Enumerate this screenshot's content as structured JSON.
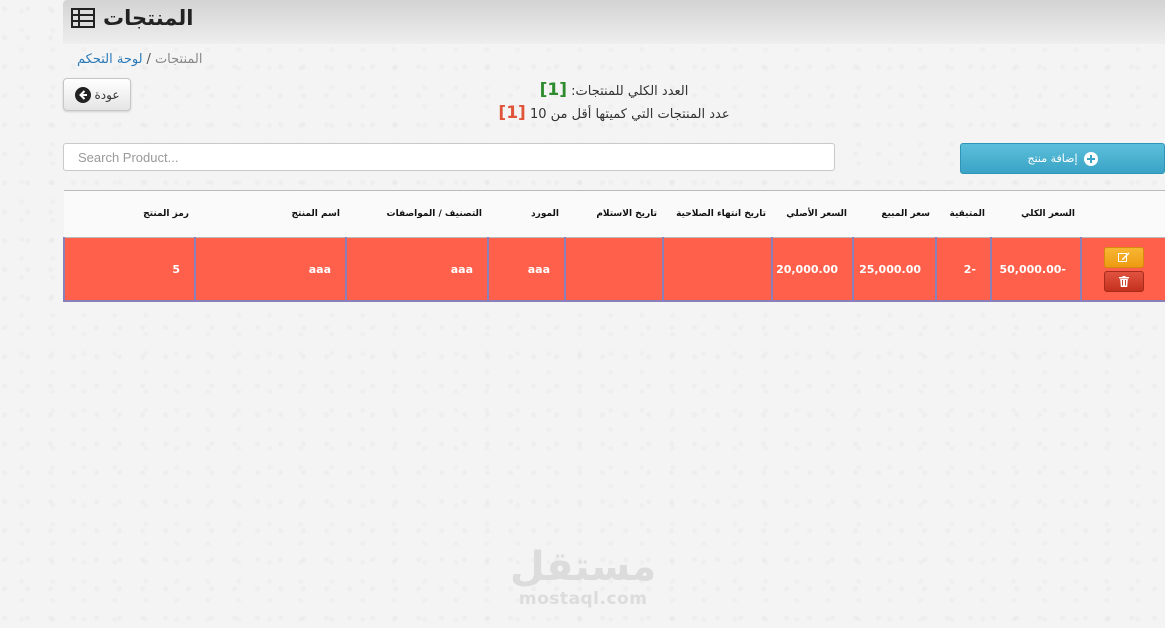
{
  "header": {
    "title": "المنتجات",
    "icon": "table-grid-icon"
  },
  "breadcrumb": {
    "current": "المنتجات",
    "separator": "/",
    "link": "لوحة التحكم"
  },
  "back_button": {
    "label": "عودة",
    "icon": "arrow-left-circle-icon"
  },
  "stats": {
    "total_label": "العدد الكلي للمنتجات:",
    "total_value": "[1]",
    "low_stock_label": "عدد المنتجات التي كميتها أقل من 10",
    "low_stock_value": "[1]"
  },
  "search": {
    "placeholder": "Search Product..."
  },
  "add_button": {
    "label": "إضافة منتج",
    "icon": "plus-circle-icon"
  },
  "table": {
    "columns": [
      "رمز المنتج",
      "اسم المنتج",
      "التصنيف / المواصفات",
      "المورد",
      "تاريخ الاستلام",
      "تاريخ انتهاء الصلاحية",
      "السعر الأصلي",
      "سعر المبيع",
      "المتبقية",
      "السعر الكلي",
      ""
    ],
    "rows": [
      {
        "code": "5",
        "name": "aaa",
        "category": "aaa",
        "supplier": "aaa",
        "received_date": "",
        "expiry_date": "",
        "original_price": "20,000.00",
        "sale_price": "25,000.00",
        "remaining": "-2",
        "total_price": "-50,000.00"
      }
    ],
    "row_highlight_color": "#ff604b"
  },
  "watermark": {
    "arabic": "مستقل",
    "latin": "mostaql.com"
  }
}
